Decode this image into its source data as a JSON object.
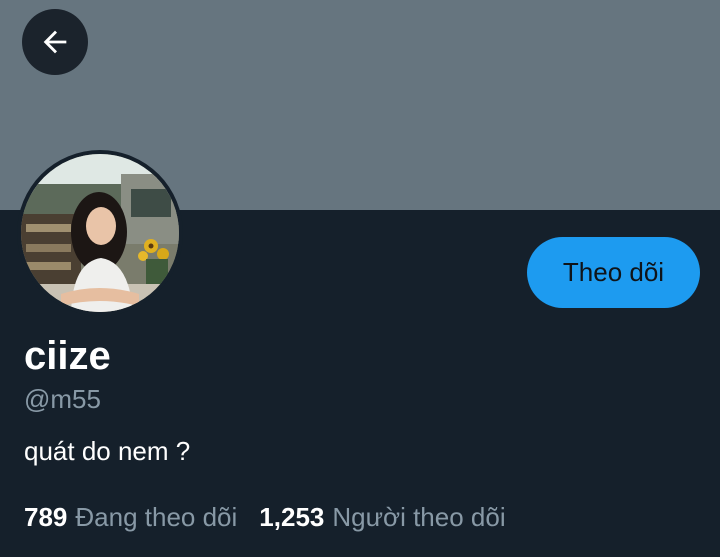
{
  "header": {
    "back_icon": "arrow-left-icon"
  },
  "profile": {
    "display_name": "ciize",
    "handle": "@m55",
    "bio": "quát do nem ?",
    "follow_button_label": "Theo dõi",
    "following_count": "789",
    "following_label": "Đang theo dõi",
    "followers_count": "1,253",
    "followers_label": "Người theo dõi"
  },
  "colors": {
    "background": "#15202b",
    "banner": "#66757f",
    "accent": "#1d9bf0",
    "secondary_text": "#8899a6"
  }
}
